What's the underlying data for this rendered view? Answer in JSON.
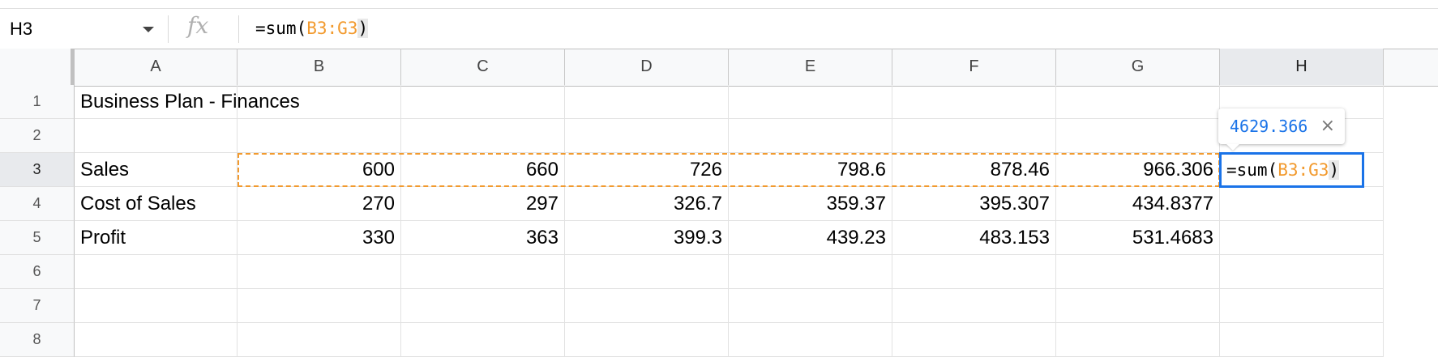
{
  "name_box": "H3",
  "formula_bar": {
    "fx": "fx",
    "prefix": "=sum(",
    "range": "B3:G3",
    "suffix": ")"
  },
  "columns": [
    "A",
    "B",
    "C",
    "D",
    "E",
    "F",
    "G",
    "H"
  ],
  "rows": [
    "1",
    "2",
    "3",
    "4",
    "5",
    "6",
    "7",
    "8"
  ],
  "cells": {
    "A1": "Business Plan - Finances",
    "A3": "Sales",
    "A4": "Cost of Sales",
    "A5": "Profit",
    "B3": "600",
    "C3": "660",
    "D3": "726",
    "E3": "798.6",
    "F3": "878.46",
    "G3": "966.306",
    "B4": "270",
    "C4": "297",
    "D4": "326.7",
    "E4": "359.37",
    "F4": "395.307",
    "G4": "434.8377",
    "B5": "330",
    "C5": "363",
    "D5": "399.3",
    "E5": "439.23",
    "F5": "483.153",
    "G5": "531.4683"
  },
  "active_cell": {
    "ref": "H3",
    "prefix": "=sum(",
    "range": "B3:G3",
    "suffix": ")"
  },
  "tooltip": {
    "value": "4629.366",
    "close": "×"
  },
  "colors": {
    "accent": "#1a73e8",
    "range": "#f29a2e"
  }
}
